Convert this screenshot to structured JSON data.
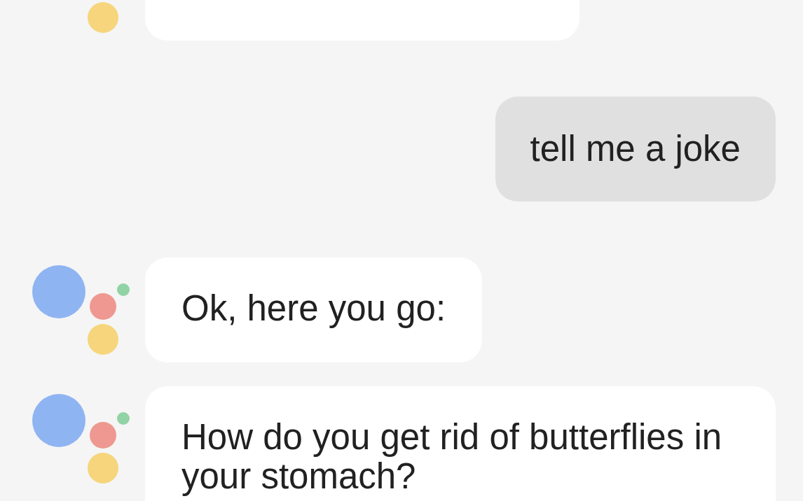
{
  "messages": [
    {
      "kind": "assistant"
    },
    {
      "kind": "user",
      "text": "tell me a joke"
    },
    {
      "kind": "assistant",
      "text": "Ok, here you go:"
    },
    {
      "kind": "assistant",
      "text": "How do you get rid of butterflies in your stomach?"
    }
  ]
}
